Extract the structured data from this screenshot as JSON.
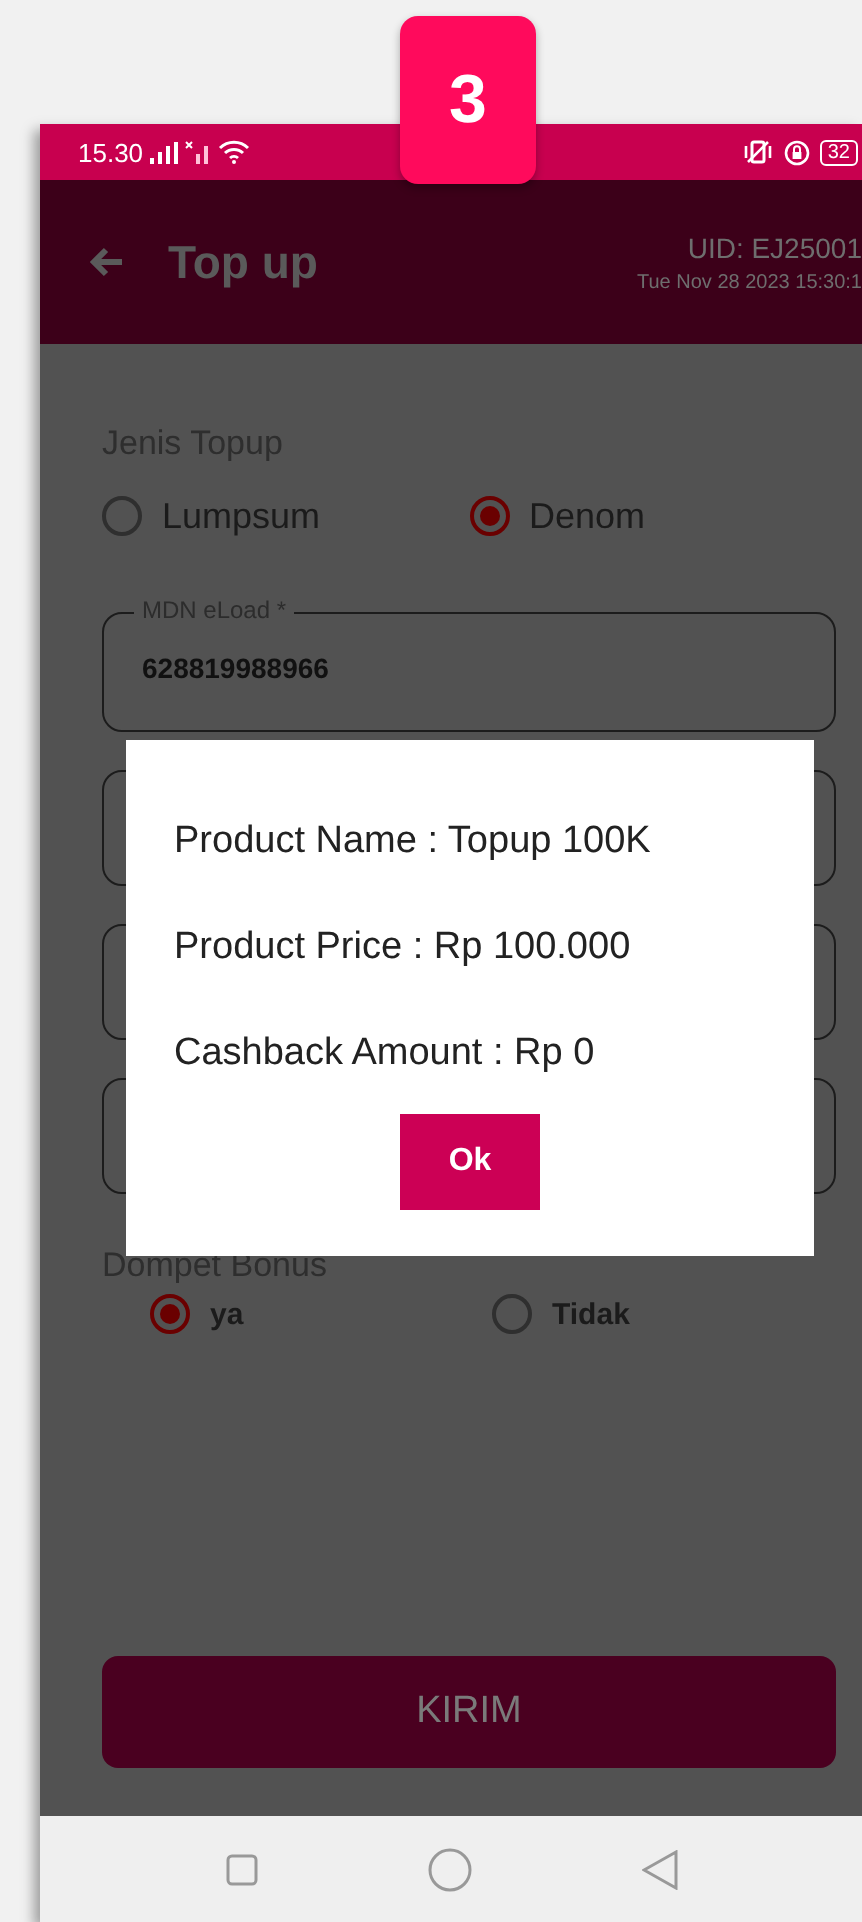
{
  "badge": "3",
  "status_bar": {
    "time": "15.30",
    "battery": "32"
  },
  "app_bar": {
    "title": "Top up",
    "uid": "UID: EJ25001",
    "datetime": "Tue Nov 28 2023 15:30:1"
  },
  "form": {
    "topup_type": {
      "label": "Jenis Topup",
      "options": [
        {
          "label": "Lumpsum",
          "selected": false
        },
        {
          "label": "Denom",
          "selected": true
        }
      ]
    },
    "mdn_field": {
      "label": "MDN eLoad *",
      "value": "628819988966"
    },
    "bonus_wallet": {
      "label": "Dompet Bonus",
      "options": [
        {
          "label": "ya",
          "selected": true
        },
        {
          "label": "Tidak",
          "selected": false
        }
      ]
    },
    "submit_button": "KIRIM"
  },
  "dialog": {
    "lines": [
      "Product Name : Topup 100K",
      "Product Price : Rp 100.000",
      "Cashback Amount : Rp 0"
    ],
    "button": "Ok"
  }
}
